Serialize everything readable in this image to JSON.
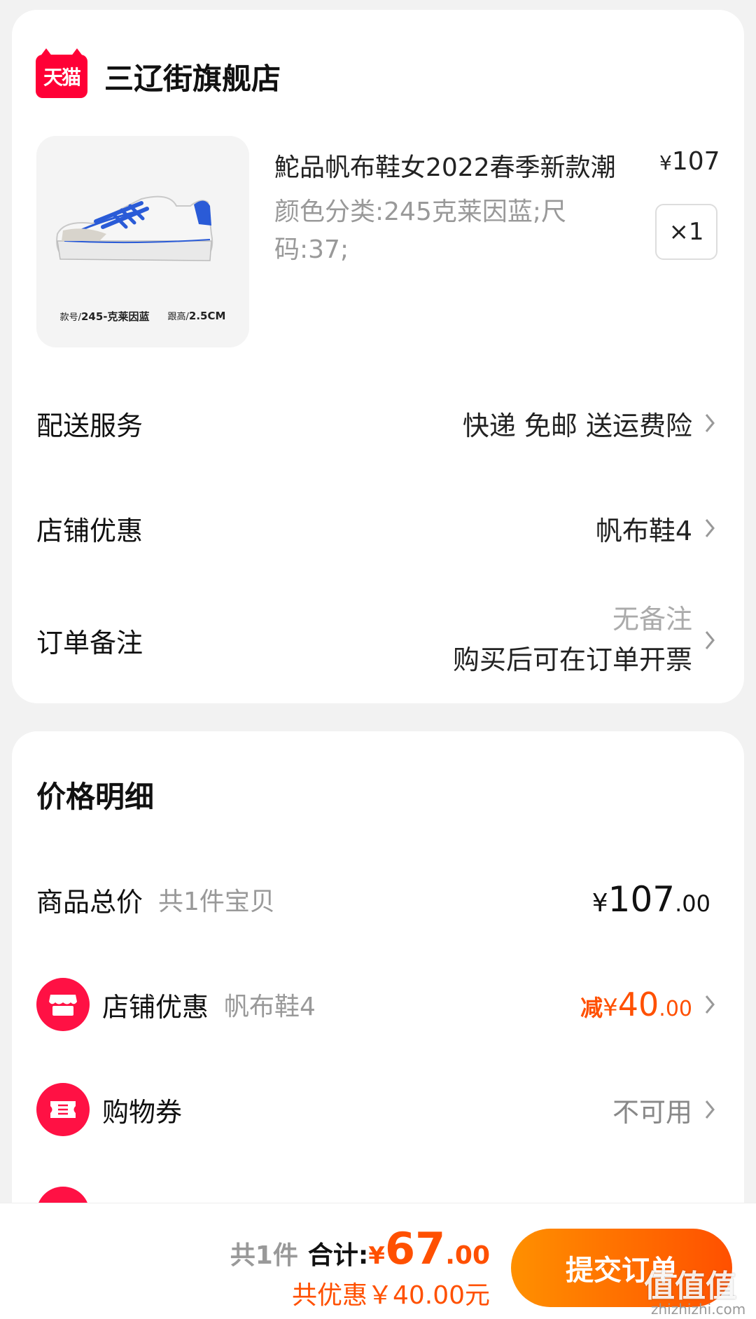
{
  "shop": {
    "badge": "天猫",
    "name": "三辽街旗舰店"
  },
  "product": {
    "title": "鮀品帆布鞋女2022春季新款潮",
    "price_symbol": "¥",
    "price": "107",
    "spec": "颜色分类:245克莱因蓝;尺码:37;",
    "quantity": "×1",
    "image_caption_label1": "款号/",
    "image_caption_value1": "245-克莱因蓝",
    "image_caption_label2": "跟高/",
    "image_caption_value2": "2.5CM"
  },
  "delivery": {
    "label": "配送服务",
    "value": "快递 免邮 送运费险"
  },
  "shop_discount_row": {
    "label": "店铺优惠",
    "value": "帆布鞋4"
  },
  "order_note": {
    "label": "订单备注",
    "line1": "无备注",
    "line2": "购买后可在订单开票"
  },
  "price_detail": {
    "title": "价格明细",
    "goods_total_label": "商品总价",
    "goods_total_sub": "共1件宝贝",
    "goods_total_yen": "¥",
    "goods_total_int": "107",
    "goods_total_dec": ".00",
    "shop_discount_label": "店铺优惠",
    "shop_discount_sub": "帆布鞋4",
    "shop_discount_prefix": "减",
    "shop_discount_yen": "¥",
    "shop_discount_int": "40",
    "shop_discount_dec": ".00",
    "coupon_label": "购物券",
    "coupon_value": "不可用"
  },
  "bottom": {
    "count": "共1件",
    "total_label": "合计:",
    "total_yen": "¥",
    "total_int": "67",
    "total_dec": ".00",
    "saved": "共优惠￥40.00元",
    "submit": "提交订单"
  },
  "watermark": {
    "text": "值值值",
    "url": "zhizhizhi.com"
  },
  "colors": {
    "accent": "#ff5000",
    "tmall_red": "#ff0036",
    "icon_red": "#ff1144"
  },
  "icons": [
    "tmall-logo",
    "chevron-right-icon",
    "store-icon",
    "ticket-icon"
  ]
}
